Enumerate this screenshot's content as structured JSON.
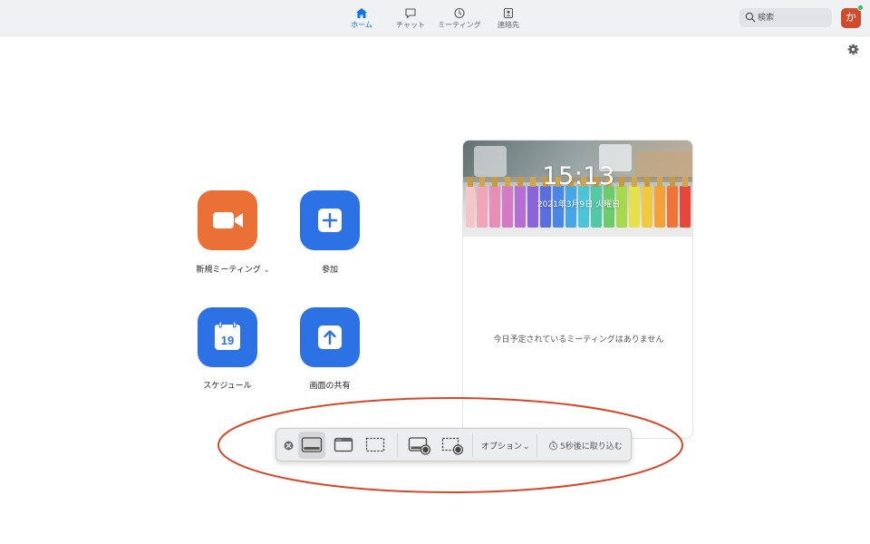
{
  "nav": {
    "tabs": [
      {
        "label": "ホーム",
        "icon": "home-icon",
        "active": true
      },
      {
        "label": "チャット",
        "icon": "chat-icon",
        "active": false
      },
      {
        "label": "ミーティング",
        "icon": "clock-icon",
        "active": false
      },
      {
        "label": "連絡先",
        "icon": "contacts-icon",
        "active": false
      }
    ],
    "search_placeholder": "検索",
    "avatar_initial": "か",
    "accent_color": "#0e72ed"
  },
  "actions": {
    "new_meeting": {
      "label": "新規ミーティング",
      "color": "#eb7035",
      "icon": "video-camera-icon"
    },
    "join": {
      "label": "参加",
      "color": "#2d72e5",
      "icon": "plus-icon"
    },
    "schedule": {
      "label": "スケジュール",
      "color": "#2d72e5",
      "icon": "calendar-icon",
      "calendar_day": "19"
    },
    "share_screen": {
      "label": "画面の共有",
      "color": "#2d72e5",
      "icon": "upload-arrow-icon"
    }
  },
  "panel": {
    "time": "15:13",
    "date": "2021年3月9日 火曜日",
    "empty_message": "今日予定されているミーティングはありません"
  },
  "capture_toolbar": {
    "options_label": "オプション",
    "timer_label": "5秒後に取り込む",
    "buttons": [
      "capture-entire-screen-icon",
      "capture-window-icon",
      "capture-selection-icon",
      "record-entire-screen-icon",
      "record-selection-icon"
    ]
  },
  "annotation_color": "#d9472b"
}
